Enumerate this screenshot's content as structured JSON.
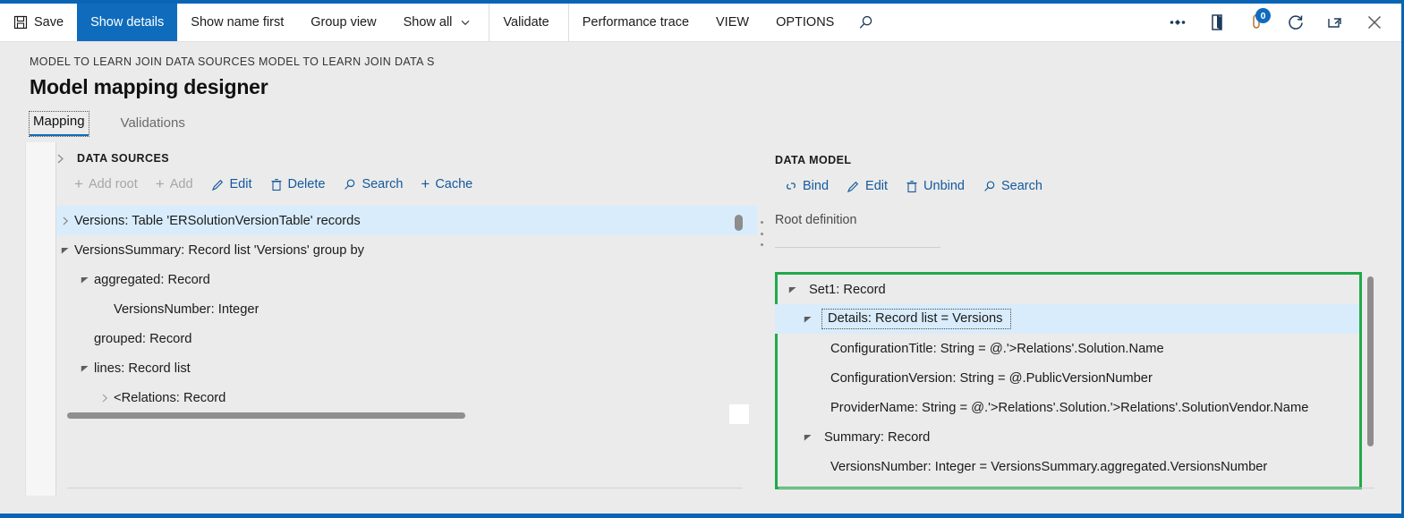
{
  "toolbar": {
    "save": "Save",
    "show_details": "Show details",
    "show_name_first": "Show name first",
    "group_view": "Group view",
    "show_all": "Show all",
    "validate": "Validate",
    "performance_trace": "Performance trace",
    "view": "VIEW",
    "options": "OPTIONS",
    "search_icon": "search-icon",
    "save_icon": "save-disk-icon",
    "caret": "˅",
    "right_icons": [
      {
        "name": "diamond-settings-icon"
      },
      {
        "name": "book-open-icon"
      },
      {
        "name": "notifications-icon",
        "badge": "0"
      },
      {
        "name": "refresh-icon"
      },
      {
        "name": "popout-icon"
      },
      {
        "name": "close-icon"
      }
    ]
  },
  "header": {
    "breadcrumb": "MODEL TO LEARN JOIN DATA SOURCES MODEL TO LEARN JOIN DATA S",
    "title": "Model mapping designer"
  },
  "tabs": [
    {
      "label": "Mapping",
      "selected": true
    },
    {
      "label": "Validations",
      "selected": false
    }
  ],
  "data_sources": {
    "panel_title": "DATA SOURCES",
    "expander_icon": "chevron-right-icon",
    "actions": [
      {
        "label": "Add root",
        "icon": "plus-icon",
        "enabled": false
      },
      {
        "label": "Add",
        "icon": "plus-icon",
        "enabled": false
      },
      {
        "label": "Edit",
        "icon": "pencil-icon",
        "enabled": true
      },
      {
        "label": "Delete",
        "icon": "trash-icon",
        "enabled": true
      },
      {
        "label": "Search",
        "icon": "magnifier-icon",
        "enabled": true
      },
      {
        "label": "Cache",
        "icon": "plus-icon",
        "enabled": true
      }
    ],
    "tree": [
      {
        "label": "Versions: Table 'ERSolutionVersionTable' records",
        "indent": 1,
        "twisty": "collapsed",
        "selected": true
      },
      {
        "label": "VersionsSummary: Record list 'Versions' group by",
        "indent": 1,
        "twisty": "expanded",
        "selected": false
      },
      {
        "label": "aggregated: Record",
        "indent": 2,
        "twisty": "expanded",
        "selected": false
      },
      {
        "label": "VersionsNumber: Integer",
        "indent": 3,
        "twisty": "none",
        "selected": false
      },
      {
        "label": "grouped: Record",
        "indent": 2,
        "twisty": "none",
        "selected": false
      },
      {
        "label": "lines: Record list",
        "indent": 2,
        "twisty": "expanded",
        "selected": false
      },
      {
        "label": "<Relations: Record",
        "indent": 3,
        "twisty": "collapsed",
        "selected": false
      }
    ]
  },
  "data_model": {
    "panel_title": "DATA MODEL",
    "actions": [
      {
        "label": "Bind",
        "icon": "link-icon",
        "enabled": true
      },
      {
        "label": "Edit",
        "icon": "pencil-icon",
        "enabled": true
      },
      {
        "label": "Unbind",
        "icon": "trash-icon",
        "enabled": true
      },
      {
        "label": "Search",
        "icon": "magnifier-icon",
        "enabled": true
      }
    ],
    "root_definition": "Root definition",
    "tree": [
      {
        "label": "Set1: Record",
        "indent": 1,
        "twisty": "expanded",
        "selected": false,
        "focused": false
      },
      {
        "label": "Details: Record list = Versions",
        "indent": 2,
        "twisty": "expanded",
        "selected": true,
        "focused": true
      },
      {
        "label": "ConfigurationTitle: String = @.'>Relations'.Solution.Name",
        "indent": 3,
        "twisty": "none",
        "selected": false,
        "focused": false
      },
      {
        "label": "ConfigurationVersion: String = @.PublicVersionNumber",
        "indent": 3,
        "twisty": "none",
        "selected": false,
        "focused": false
      },
      {
        "label": "ProviderName: String = @.'>Relations'.Solution.'>Relations'.SolutionVendor.Name",
        "indent": 3,
        "twisty": "none",
        "selected": false,
        "focused": false
      },
      {
        "label": "Summary: Record",
        "indent": 2,
        "twisty": "expanded",
        "selected": false,
        "focused": false
      },
      {
        "label": "VersionsNumber: Integer = VersionsSummary.aggregated.VersionsNumber",
        "indent": 3,
        "twisty": "none",
        "selected": false,
        "focused": false
      }
    ],
    "highlight_color": "#1faa4c"
  },
  "colors": {
    "accent": "#0f6cbd",
    "link": "#13599c",
    "selection": "#d9ecfb",
    "page_bg": "#ebebeb",
    "highlight_border": "#1faa4c"
  }
}
